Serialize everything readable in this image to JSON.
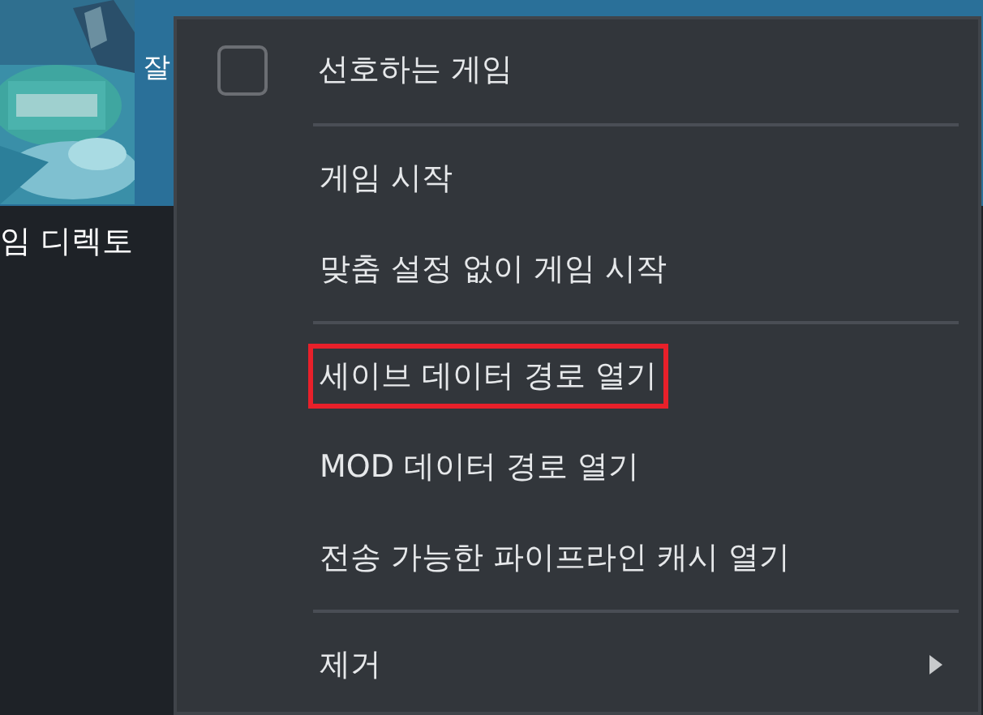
{
  "background": {
    "title_fragment": "잘",
    "label_fragment": "임 디렉토"
  },
  "context_menu": {
    "items": [
      {
        "kind": "checkbox",
        "label": "선호하는 게임",
        "checked": false
      },
      {
        "kind": "separator"
      },
      {
        "kind": "item",
        "label": "게임 시작",
        "highlighted": false
      },
      {
        "kind": "item",
        "label": "맞춤 설정 없이 게임 시작",
        "highlighted": false
      },
      {
        "kind": "separator"
      },
      {
        "kind": "item",
        "label": "세이브 데이터 경로 열기",
        "highlighted": true
      },
      {
        "kind": "item",
        "label": "MOD 데이터 경로 열기",
        "highlighted": false
      },
      {
        "kind": "item",
        "label": "전송 가능한 파이프라인 캐시 열기",
        "highlighted": false
      },
      {
        "kind": "separator"
      },
      {
        "kind": "submenu",
        "label": "제거"
      }
    ]
  }
}
